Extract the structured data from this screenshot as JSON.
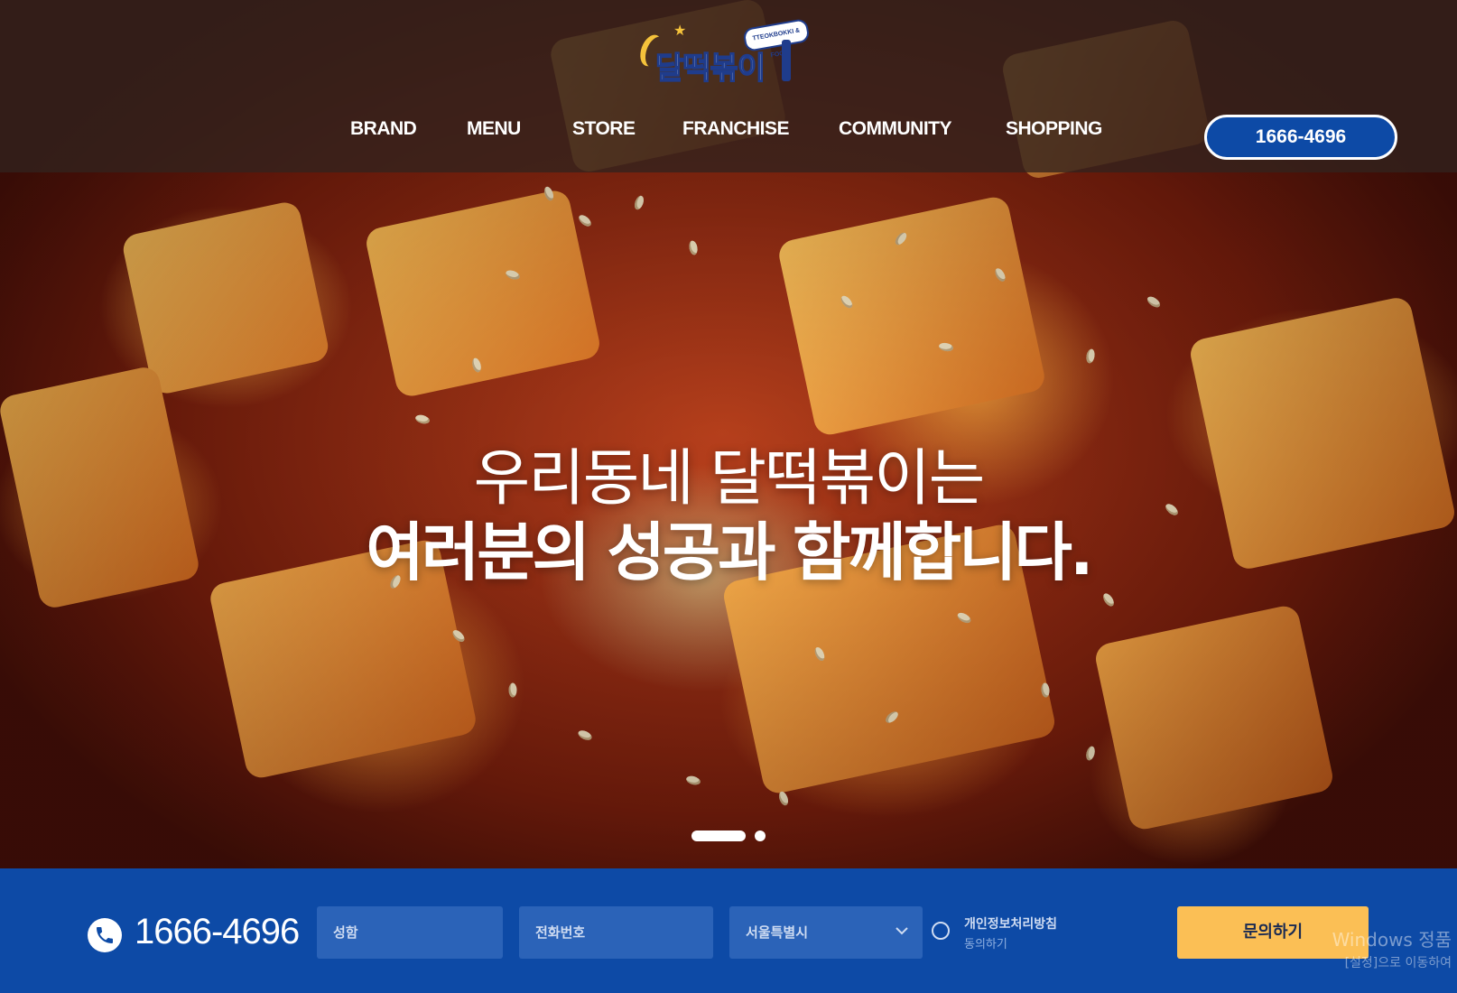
{
  "brand": {
    "name": "달떡볶이",
    "banner": "TTEOKBOKKI & FOOD"
  },
  "nav": {
    "items": [
      {
        "label": "BRAND"
      },
      {
        "label": "MENU"
      },
      {
        "label": "STORE"
      },
      {
        "label": "FRANCHISE"
      },
      {
        "label": "COMMUNITY"
      },
      {
        "label": "SHOPPING"
      }
    ],
    "phone_button": "1666-4696"
  },
  "hero": {
    "line1": "우리동네 달떡볶이는",
    "line2": "여러분의 성공과 함께합니다.",
    "slides_total": 2,
    "active_slide": 1
  },
  "inquiry": {
    "phone": "1666-4696",
    "name_placeholder": "성함",
    "phone_placeholder": "전화번호",
    "region_selected": "서울특별시",
    "privacy_title": "개인정보처리방침",
    "privacy_agree": "동의하기",
    "submit_label": "문의하기"
  },
  "watermark": {
    "line1": "Windows 정품",
    "line2": "[설정]으로 이동하여"
  },
  "colors": {
    "primary_blue": "#0d4aa6",
    "field_blue": "#2b63b8",
    "submit_yellow": "#fbbf55",
    "header_overlay": "#32221e"
  },
  "icons": {
    "phone": "phone-icon",
    "select": "chevron-down-icon",
    "radio": "radio-button"
  }
}
